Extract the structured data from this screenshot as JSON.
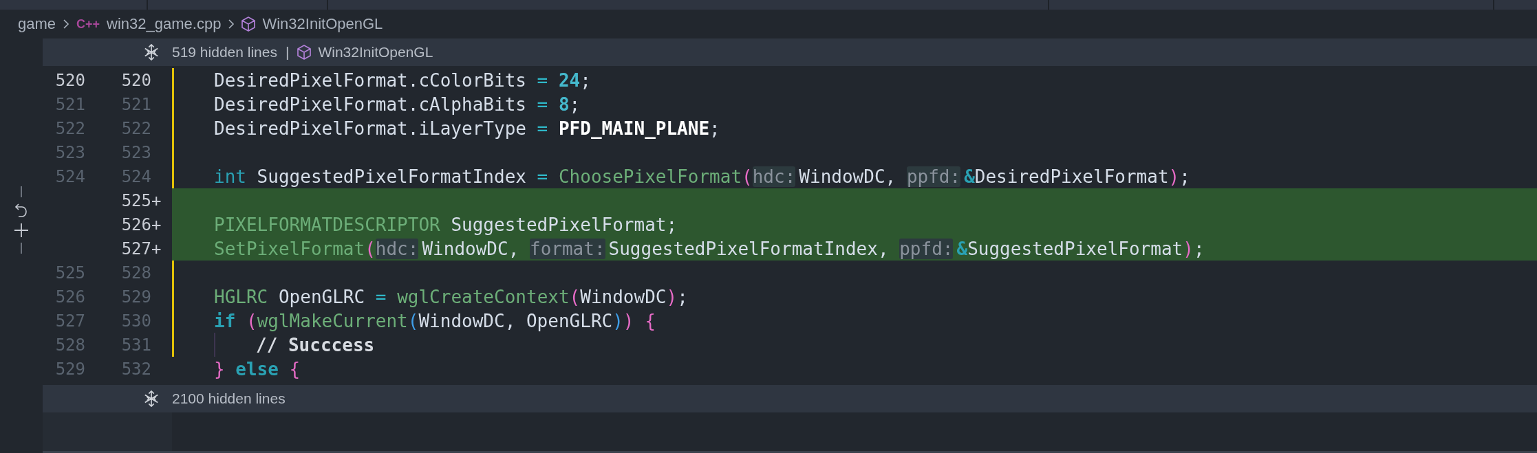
{
  "breadcrumb": {
    "folder": "game",
    "file_badge": "C++",
    "file": "win32_game.cpp",
    "symbol": "Win32InitOpenGL"
  },
  "fold_top": {
    "text": "519 hidden lines",
    "separator": "|",
    "symbol": "Win32InitOpenGL"
  },
  "lines": [
    {
      "old": "520",
      "new": "520",
      "current": true,
      "added": false,
      "modified": true,
      "nested": false,
      "tokens": [
        {
          "kind": "plain",
          "text": "DesiredPixelFormat.cColorBits"
        },
        {
          "kind": "op",
          "text": " = "
        },
        {
          "kind": "number",
          "text": "24"
        },
        {
          "kind": "plain",
          "text": ";"
        }
      ]
    },
    {
      "old": "521",
      "new": "521",
      "current": false,
      "added": false,
      "modified": true,
      "nested": false,
      "tokens": [
        {
          "kind": "plain",
          "text": "DesiredPixelFormat.cAlphaBits"
        },
        {
          "kind": "op",
          "text": " = "
        },
        {
          "kind": "number",
          "text": "8"
        },
        {
          "kind": "plain",
          "text": ";"
        }
      ]
    },
    {
      "old": "522",
      "new": "522",
      "current": false,
      "added": false,
      "modified": true,
      "nested": false,
      "tokens": [
        {
          "kind": "plain",
          "text": "DesiredPixelFormat.iLayerType"
        },
        {
          "kind": "op",
          "text": " = "
        },
        {
          "kind": "const",
          "text": "PFD_MAIN_PLANE"
        },
        {
          "kind": "plain",
          "text": ";"
        }
      ]
    },
    {
      "old": "523",
      "new": "523",
      "current": false,
      "added": false,
      "modified": true,
      "nested": false
    },
    {
      "old": "524",
      "new": "524",
      "current": false,
      "added": false,
      "modified": true,
      "nested": false,
      "tokens": [
        {
          "kind": "keyword",
          "text": "int"
        },
        {
          "kind": "plain",
          "text": " SuggestedPixelFormatIndex"
        },
        {
          "kind": "op",
          "text": " = "
        },
        {
          "kind": "func",
          "text": "ChoosePixelFormat"
        },
        {
          "kind": "paren",
          "text": "("
        },
        {
          "kind": "hint",
          "text": "hdc:"
        },
        {
          "kind": "plain",
          "text": "WindowDC, "
        },
        {
          "kind": "hint",
          "text": "ppfd:"
        },
        {
          "kind": "amp",
          "text": "&"
        },
        {
          "kind": "plain",
          "text": "DesiredPixelFormat"
        },
        {
          "kind": "paren",
          "text": ")"
        },
        {
          "kind": "plain",
          "text": ";"
        }
      ]
    },
    {
      "new": "525",
      "marker": "+",
      "current": false,
      "added": true,
      "modified": true,
      "nested": false
    },
    {
      "new": "526",
      "marker": "+",
      "current": false,
      "added": true,
      "modified": true,
      "nested": false,
      "tokens": [
        {
          "kind": "func",
          "text": "PIXELFORMATDESCRIPTOR"
        },
        {
          "kind": "plain",
          "text": " SuggestedPixelFormat;"
        }
      ]
    },
    {
      "new": "527",
      "marker": "+",
      "current": false,
      "added": true,
      "modified": true,
      "nested": false,
      "tokens": [
        {
          "kind": "func",
          "text": "SetPixelFormat"
        },
        {
          "kind": "paren",
          "text": "("
        },
        {
          "kind": "hint",
          "text": "hdc:"
        },
        {
          "kind": "plain",
          "text": "WindowDC, "
        },
        {
          "kind": "hint",
          "text": "format:"
        },
        {
          "kind": "plain",
          "text": "SuggestedPixelFormatIndex, "
        },
        {
          "kind": "hint",
          "text": "ppfd:"
        },
        {
          "kind": "amp",
          "text": "&"
        },
        {
          "kind": "plain",
          "text": "SuggestedPixelFormat"
        },
        {
          "kind": "paren",
          "text": ")"
        },
        {
          "kind": "plain",
          "text": ";"
        }
      ]
    },
    {
      "old": "525",
      "new": "528",
      "current": false,
      "added": false,
      "modified": true,
      "nested": false
    },
    {
      "old": "526",
      "new": "529",
      "current": false,
      "added": false,
      "modified": true,
      "nested": false,
      "tokens": [
        {
          "kind": "func",
          "text": "HGLRC"
        },
        {
          "kind": "plain",
          "text": " OpenGLRC"
        },
        {
          "kind": "op",
          "text": " = "
        },
        {
          "kind": "func",
          "text": "wglCreateContext"
        },
        {
          "kind": "paren",
          "text": "("
        },
        {
          "kind": "plain",
          "text": "WindowDC"
        },
        {
          "kind": "paren",
          "text": ")"
        },
        {
          "kind": "plain",
          "text": ";"
        }
      ]
    },
    {
      "old": "527",
      "new": "530",
      "current": false,
      "added": false,
      "modified": true,
      "nested": false,
      "tokens": [
        {
          "kind": "control",
          "text": "if"
        },
        {
          "kind": "paren",
          "text": " ("
        },
        {
          "kind": "func",
          "text": "wglMakeCurrent"
        },
        {
          "kind": "paren2",
          "text": "("
        },
        {
          "kind": "plain",
          "text": "WindowDC, OpenGLRC"
        },
        {
          "kind": "paren2",
          "text": ")"
        },
        {
          "kind": "paren",
          "text": ")"
        },
        {
          "kind": "paren",
          "text": " {"
        }
      ]
    },
    {
      "old": "528",
      "new": "531",
      "current": false,
      "added": false,
      "modified": true,
      "nested": true,
      "tokens": [
        {
          "kind": "comment",
          "text": "// Succcess"
        }
      ]
    },
    {
      "old": "529",
      "new": "532",
      "current": false,
      "added": false,
      "modified": false,
      "nested": false,
      "tokens": [
        {
          "kind": "paren",
          "text": "}"
        },
        {
          "kind": "control",
          "text": " else"
        },
        {
          "kind": "paren",
          "text": " {"
        }
      ]
    }
  ],
  "fold_bottom": {
    "text": "2100 hidden lines"
  }
}
